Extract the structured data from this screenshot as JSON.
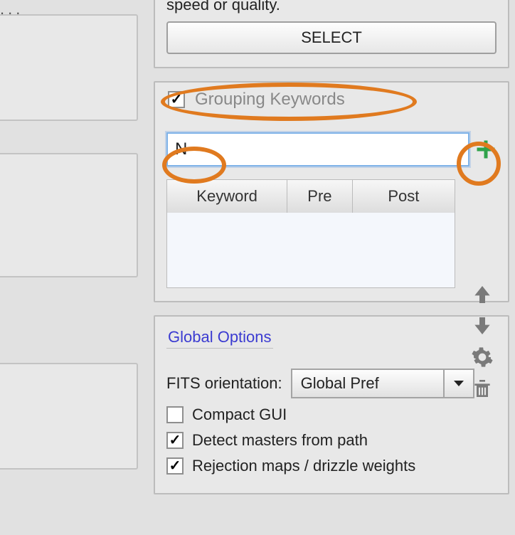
{
  "select_panel": {
    "text_fragment": "speed or quality.",
    "button_label": "SELECT"
  },
  "grouping": {
    "enabled": true,
    "title": "Grouping Keywords",
    "input_value": "N",
    "table": {
      "columns": [
        "Keyword",
        "Pre",
        "Post"
      ]
    },
    "icons": {
      "add": "plus-icon",
      "up": "arrow-up-icon",
      "down": "arrow-down-icon",
      "gear": "gear-icon",
      "trash": "trash-icon"
    }
  },
  "global_options": {
    "title": "Global Options",
    "fits_label": "FITS orientation:",
    "fits_value": "Global Pref",
    "compact_gui": {
      "label": "Compact GUI",
      "checked": false
    },
    "detect_masters": {
      "label": "Detect masters from path",
      "checked": true
    },
    "rejection_maps": {
      "label": "Rejection maps / drizzle weights",
      "checked": true
    }
  },
  "left_placeholder": "..."
}
